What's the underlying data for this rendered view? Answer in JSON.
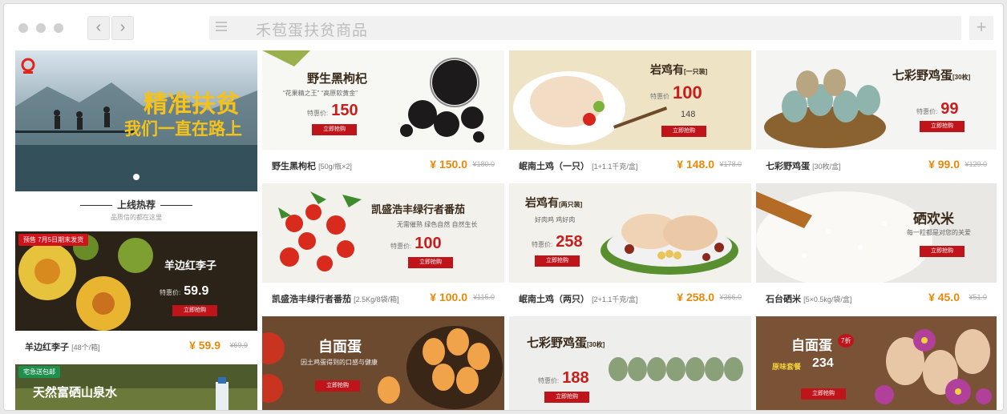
{
  "browser": {
    "title": "禾苞蛋扶贫商品",
    "back": "‹",
    "forward": "›",
    "plus": "+"
  },
  "hero": {
    "headline": "精准扶贫",
    "subline": "我们一直在路上",
    "section_title": "上线热荐",
    "section_sub": "品质信的都在这里"
  },
  "tiles": [
    {
      "id": "goji",
      "ad_title": "野生黑枸杞",
      "ad_sub": "“花果精之王” “高原软黄金”",
      "ad_label": "特惠价:",
      "ad_price": "150",
      "ad_btn": "立即抢购",
      "name": "野生黑枸杞",
      "spec": "[50g/瓶×2]",
      "price": "¥ 150.0",
      "old": "¥180.0"
    },
    {
      "id": "chicken1",
      "ad_title": "岩鸡有",
      "ad_title_spec": "[一只装]",
      "ad_label": "特惠价",
      "ad_price": "100",
      "ad_old_price": "148",
      "ad_btn": "立即抢购",
      "name": "岷南土鸡（一只）",
      "spec": "[1+1.1千克/盒]",
      "price": "¥ 148.0",
      "old": "¥178.0"
    },
    {
      "id": "eggs",
      "ad_title": "七彩野鸡蛋",
      "ad_title_spec": "[30枚]",
      "ad_label": "特惠价:",
      "ad_price": "99",
      "ad_btn": "立即抢购",
      "name": "七彩野鸡蛋",
      "spec": "[30枚/盒]",
      "price": "¥ 99.0",
      "old": "¥129.0"
    },
    {
      "id": "tomato",
      "ad_title": "凯盛浩丰绿行者番茄",
      "ad_sub": "无需催熟  绿色自然  自然生长",
      "ad_label": "特惠价:",
      "ad_price": "100",
      "ad_btn": "立即抢购",
      "name": "凯盛浩丰绿行者番茄",
      "spec": "[2.5Kg/8袋/箱]",
      "price": "¥ 100.0",
      "old": "¥115.0"
    },
    {
      "id": "chicken2",
      "ad_title": "岩鸡有",
      "ad_title_spec": "[两只装]",
      "ad_sub": "好肉鸡  鸡好肉",
      "ad_label": "特惠价:",
      "ad_price": "258",
      "ad_btn": "立即抢购",
      "name": "岷南土鸡（两只）",
      "spec": "[2+1.1千克/盒]",
      "price": "¥ 258.0",
      "old": "¥366.0"
    },
    {
      "id": "rice",
      "ad_title": "硒欢米",
      "ad_sub": "每一粒都是对您的关爱",
      "ad_btn": "立即抢购",
      "name": "石台硒米",
      "spec": "[5×0.5kg/袋/盒]",
      "price": "¥ 45.0",
      "old": "¥51.0"
    },
    {
      "id": "plum",
      "badge": "预售 7月5日期末发货",
      "ad_title": "羊边红李子",
      "ad_label": "特惠价:",
      "ad_price": "59.9",
      "ad_btn": "立即抢购",
      "name": "羊边红李子",
      "spec": "[48个/箱]",
      "price": "¥ 59.9",
      "old": "¥69.9"
    },
    {
      "id": "eggs2",
      "ad_title": "自面蛋",
      "ad_sub": "因土鸡蛋得到的口感与健康",
      "ad_btn": "立即抢购"
    },
    {
      "id": "pheasant",
      "ad_title": "七彩野鸡蛋",
      "ad_title_spec": "[30枚]",
      "ad_label": "特惠价:",
      "ad_price": "188",
      "ad_btn": "立即抢购"
    },
    {
      "id": "eggs3",
      "badge": "7折",
      "ad_title": "自面蛋",
      "ad_sub": "原味套餐",
      "ad_price": "234",
      "ad_btn": "立即抢购"
    },
    {
      "id": "water",
      "badge": "宅急送包邮",
      "ad_title": "天然富硒山泉水"
    }
  ],
  "colors": {
    "accent_red": "#c0141b",
    "price_orange": "#e8890a",
    "chrome": "#f1f1f1"
  }
}
